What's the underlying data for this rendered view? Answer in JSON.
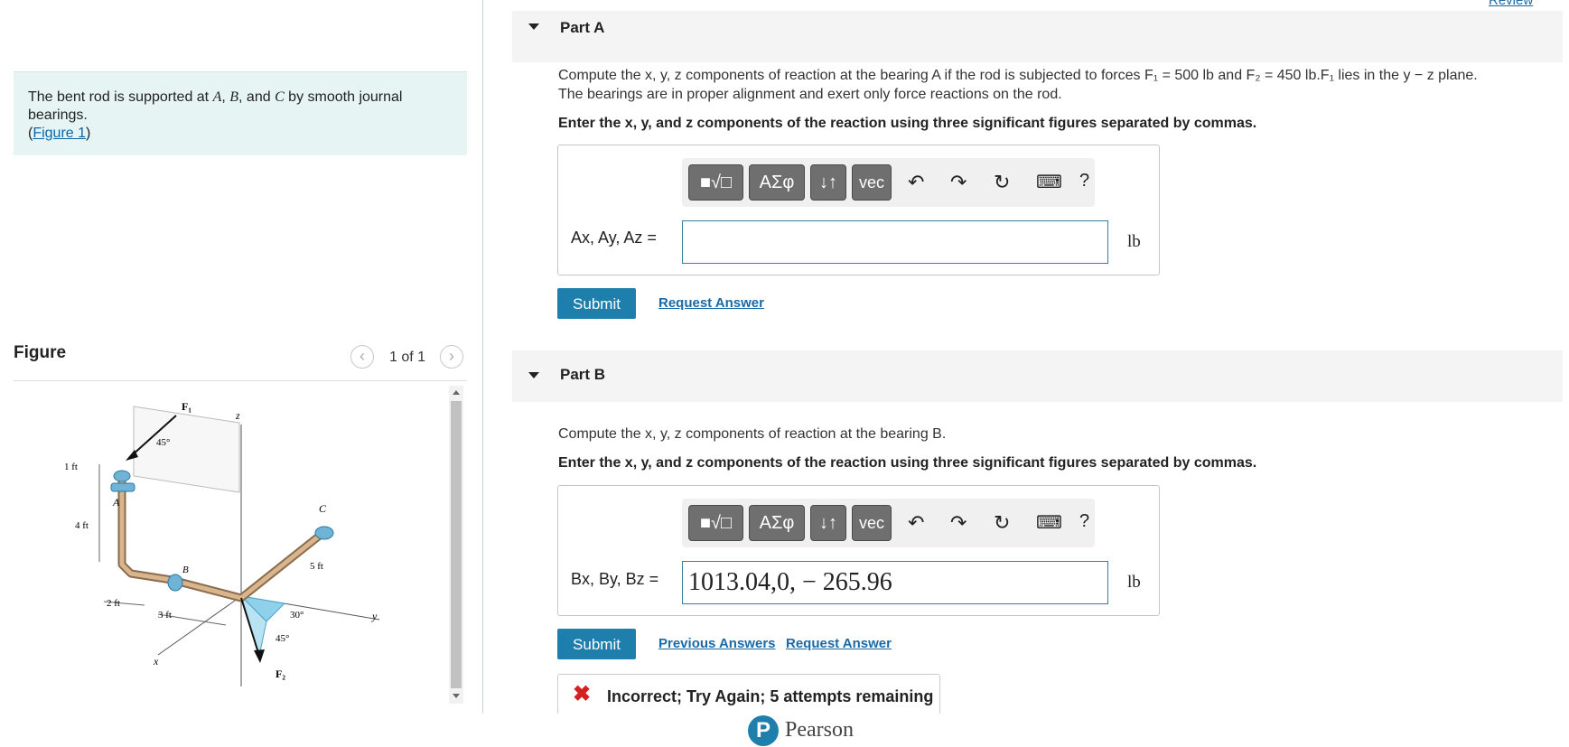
{
  "problem": {
    "text_prefix": "The bent rod is supported at ",
    "var_a": "A",
    "sep1": ", ",
    "var_b": "B",
    "sep2": ", and ",
    "var_c": "C",
    "text_suffix": " by smooth journal bearings.",
    "figure_link": "Figure 1"
  },
  "figure_panel": {
    "title": "Figure",
    "pager": "1 of 1",
    "prev_icon": "chevron-left-icon",
    "next_icon": "chevron-right-icon",
    "diagram_labels": {
      "F1": "F₁",
      "F2": "F₂",
      "z": "z",
      "y": "y",
      "x": "x",
      "A": "A",
      "B": "B",
      "C": "C",
      "angle45_top": "45°",
      "angle30": "30°",
      "angle45_bottom": "45°",
      "dim_1ft": "1 ft",
      "dim_4ft": "4 ft",
      "dim_2ft": "2 ft",
      "dim_3ft": "3 ft",
      "dim_5ft": "5 ft"
    }
  },
  "review": "Review",
  "part_a": {
    "title": "Part A",
    "question_line1": "Compute the x, y, z components of reaction at the bearing A if the rod is subjected to forces F₁ = 500 lb and F₂ = 450 lb.F₁ lies in the y − z plane.",
    "question_line2": "The bearings are in proper alignment and exert only force reactions on the rod.",
    "instruction": "Enter the x, y, and z components of the reaction using three significant figures separated by commas.",
    "answer_label": "Ax, Ay, Az =",
    "answer_value": "",
    "unit": "lb",
    "submit": "Submit",
    "request_answer": "Request Answer"
  },
  "part_b": {
    "title": "Part B",
    "question": "Compute the x, y, z components of reaction at the bearing B.",
    "instruction": "Enter the x, y, and z components of the reaction using three significant figures separated by commas.",
    "answer_label": "Bx, By, Bz =",
    "answer_value": "1013.04,0, − 265.96",
    "unit": "lb",
    "submit": "Submit",
    "previous_answers": "Previous Answers",
    "request_answer": "Request Answer",
    "feedback": "Incorrect; Try Again; 5 attempts remaining"
  },
  "toolbar": {
    "templates_icon": "templates-icon",
    "greek": "ΑΣφ",
    "arrows": "↓↑",
    "vec": "vec",
    "undo_icon": "undo-icon",
    "redo_icon": "redo-icon",
    "reset_icon": "reset-icon",
    "keyboard_icon": "keyboard-icon",
    "help": "?"
  },
  "footer": {
    "brand": "Pearson",
    "logo_letter": "P"
  },
  "colors": {
    "accent": "#1e7eac",
    "problem_bg": "#e6f4f4",
    "error": "#d62020",
    "header_bg": "#f4f4f4"
  }
}
